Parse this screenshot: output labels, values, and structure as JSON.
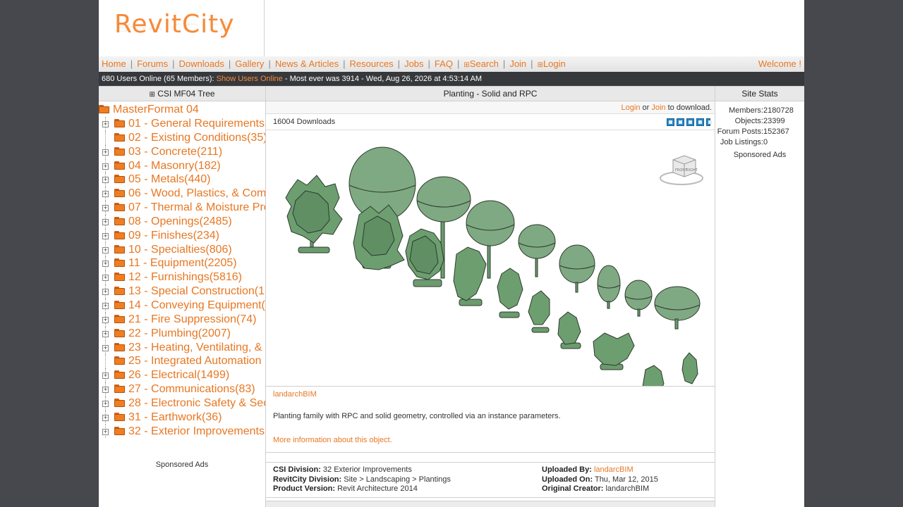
{
  "site": {
    "logo": "RevitCity"
  },
  "nav": {
    "items": [
      "Home",
      "Forums",
      "Downloads",
      "Gallery",
      "News & Articles",
      "Resources",
      "Jobs",
      "FAQ",
      "Search",
      "Join",
      "Login"
    ],
    "welcome": "Welcome !"
  },
  "status": {
    "online": "680 Users Online (65 Members):",
    "show_users": "Show Users Online",
    "most_ever": "- Most ever was 3914 - Wed, Aug 26, 2026 at 4:53:14 AM"
  },
  "left": {
    "header": "CSI MF04 Tree",
    "root": "MasterFormat 04",
    "items": [
      {
        "label": "01 - General Requirements(",
        "expandable": true
      },
      {
        "label": "02 - Existing Conditions(35)",
        "expandable": false
      },
      {
        "label": "03 - Concrete(211)",
        "expandable": true
      },
      {
        "label": "04 - Masonry(182)",
        "expandable": true
      },
      {
        "label": "05 - Metals(440)",
        "expandable": true
      },
      {
        "label": "06 - Wood, Plastics, & Comp",
        "expandable": true
      },
      {
        "label": "07 - Thermal & Moisture Pro",
        "expandable": true
      },
      {
        "label": "08 - Openings(2485)",
        "expandable": true
      },
      {
        "label": "09 - Finishes(234)",
        "expandable": true
      },
      {
        "label": "10 - Specialties(806)",
        "expandable": true
      },
      {
        "label": "11 - Equipment(2205)",
        "expandable": true
      },
      {
        "label": "12 - Furnishings(5816)",
        "expandable": true
      },
      {
        "label": "13 - Special Construction(15",
        "expandable": true
      },
      {
        "label": "14 - Conveying Equipment(",
        "expandable": true
      },
      {
        "label": "21 - Fire Suppression(74)",
        "expandable": true
      },
      {
        "label": "22 - Plumbing(2007)",
        "expandable": true
      },
      {
        "label": "23 - Heating, Ventilating, &",
        "expandable": true
      },
      {
        "label": "25 - Integrated Automation",
        "expandable": false
      },
      {
        "label": "26 - Electrical(1499)",
        "expandable": true
      },
      {
        "label": "27 - Communications(83)",
        "expandable": true
      },
      {
        "label": "28 - Electronic Safety & Sec",
        "expandable": true
      },
      {
        "label": "31 - Earthwork(36)",
        "expandable": true
      },
      {
        "label": "32 - Exterior Improvements",
        "expandable": true
      }
    ],
    "ads": "Sponsored Ads"
  },
  "center": {
    "header": "Planting - Solid and RPC",
    "login": "Login",
    "or": "or",
    "join": "Join",
    "to_download": "to download.",
    "downloads": "16004 Downloads",
    "rating": 4.5,
    "viewcube": {
      "face1": "FRONT",
      "face2": "RIGHT"
    },
    "author": "landarchBIM",
    "description": "Planting family with RPC and solid geometry, controlled via an instance parameters.",
    "more_info": "More information about this object.",
    "info": {
      "csi_label": "CSI Division:",
      "csi_value": "32 Exterior Improvements",
      "rc_label": "RevitCity Division:",
      "rc_value": "Site > Landscaping > Plantings",
      "pv_label": "Product Version:",
      "pv_value": "Revit Architecture 2014",
      "ub_label": "Uploaded By:",
      "ub_value": "landarcBIM",
      "uo_label": "Uploaded On:",
      "uo_value": "Thu, Mar 12, 2015",
      "oc_label": "Original Creator:",
      "oc_value": "landarchBIM"
    }
  },
  "right": {
    "header": "Site Stats",
    "stats": [
      {
        "k": "Members:",
        "v": "2180728"
      },
      {
        "k": "Objects:",
        "v": "23399"
      },
      {
        "k": "Forum Posts:",
        "v": "152367"
      },
      {
        "k": "Job Listings:",
        "v": "0"
      }
    ],
    "ads": "Sponsored Ads"
  },
  "colors": {
    "accent": "#e87722",
    "status_bg": "#36383c",
    "tree_fill": "#7fa982",
    "tree_dark": "#5f8f63"
  }
}
